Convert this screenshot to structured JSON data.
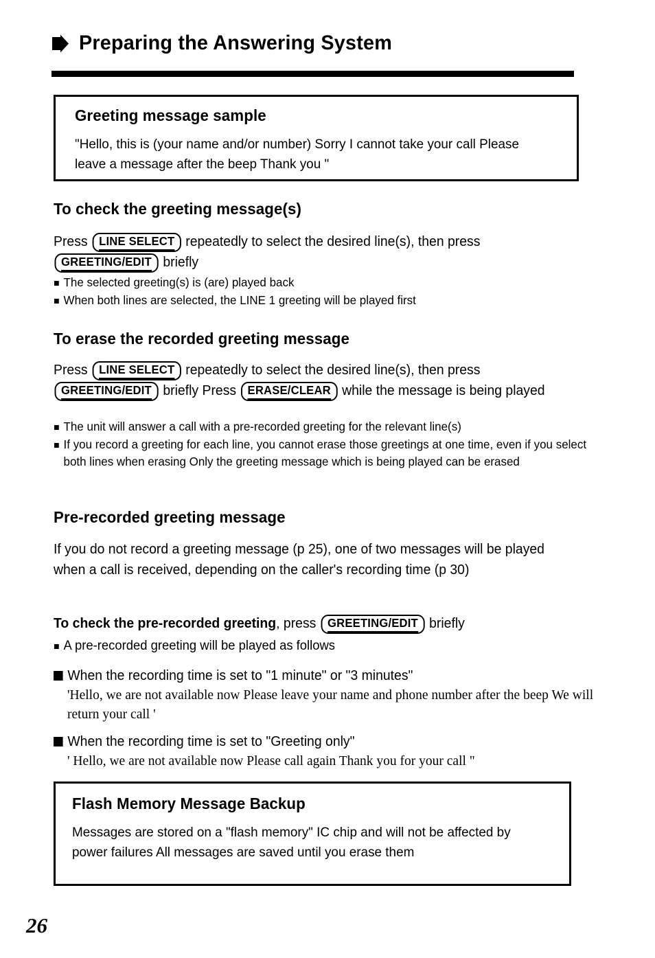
{
  "document": {
    "page_number": "26",
    "header": {
      "title": "Preparing the Answering System",
      "arrow_icon": "right-arrow-icon"
    }
  },
  "greeting_sample_box": {
    "title": "Greeting message sample",
    "body": "\"Hello, this is (your name and/or number)  Sorry I cannot take your call  Please leave a message after the beep  Thank you \""
  },
  "check_greeting": {
    "heading": "To check the greeting message(s)",
    "instruction_part_1": "Press",
    "key_1": "LINE SELECT",
    "instruction_part_2": "repeatedly to select the desired line(s), then press",
    "key_2": "GREETING/EDIT",
    "instruction_part_3": "briefly",
    "bullets": [
      "The selected greeting(s) is (are) played back",
      "When both lines are selected, the LINE 1 greeting will be played first"
    ]
  },
  "erase_greeting": {
    "heading": "To erase the recorded greeting message",
    "instruction_part_1": "Press",
    "key_1": "LINE SELECT",
    "instruction_part_2": "repeatedly to select the desired line(s), then press",
    "key_2": "GREETING/EDIT",
    "instruction_part_3": "briefly  Press",
    "key_3": "ERASE/CLEAR",
    "instruction_part_4": "while the message is being played",
    "bullets": [
      "The unit will answer a call with a pre-recorded greeting for the relevant line(s)",
      "If you record a greeting for each line, you cannot erase those greetings at one time, even if you select both lines when erasing  Only the greeting message which is being played can be erased"
    ]
  },
  "pre_recorded": {
    "heading": "Pre-recorded greeting message",
    "paragraph": "If you do not record a greeting message (p  25), one of two messages will be played when a call is received, depending on the caller's recording time (p  30)",
    "check_line_bold": "To check the pre-recorded greeting",
    "check_line_rest": ", press",
    "check_key": "GREETING/EDIT",
    "check_line_tail": "briefly",
    "bullet": "A pre-recorded greeting will be played as follows",
    "case_1": {
      "label": "When the recording time is set to \"1 minute\" or \"3 minutes\"",
      "quote": "'Hello, we are not available now  Please leave your name and phone number after the beep  We will return your call  '"
    },
    "case_2": {
      "label": "When the recording time is set to \"Greeting only\"",
      "quote": "' Hello, we are not available now  Please call again  Thank you for your call \""
    }
  },
  "flash_memory_box": {
    "title": "Flash Memory Message Backup",
    "body": "Messages are stored on a \"flash memory\" IC chip and will not be affected by power failures  All messages are saved until you erase them"
  }
}
